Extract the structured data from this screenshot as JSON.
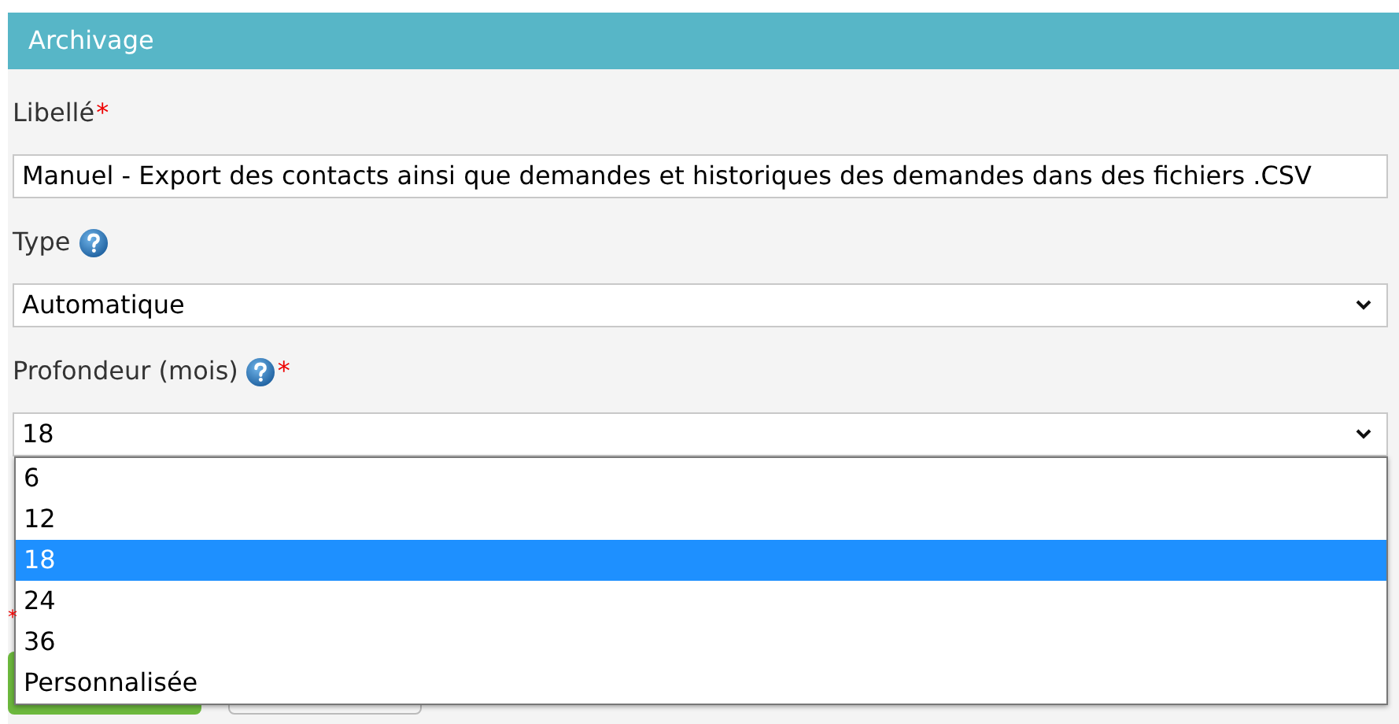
{
  "panel": {
    "title": "Archivage"
  },
  "fields": [
    {
      "kind": "text",
      "label": "Libellé",
      "required": true,
      "help": false,
      "value": "Manuel - Export des contacts ainsi que demandes et historiques des demandes dans des fichiers .CSV"
    },
    {
      "kind": "select",
      "label": "Type",
      "required": false,
      "help": true,
      "value": "Automatique"
    },
    {
      "kind": "select",
      "label": "Profondeur (mois)",
      "required": true,
      "help": true,
      "value": "18",
      "expanded": true,
      "options": [
        {
          "label": "6",
          "selected": false
        },
        {
          "label": "12",
          "selected": false
        },
        {
          "label": "18",
          "selected": true
        },
        {
          "label": "24",
          "selected": false
        },
        {
          "label": "36",
          "selected": false
        },
        {
          "label": "Personnalisée",
          "selected": false
        }
      ]
    }
  ],
  "required_note_mark": "*",
  "buttons": [
    {
      "kind": "primary"
    },
    {
      "kind": "secondary"
    }
  ]
}
